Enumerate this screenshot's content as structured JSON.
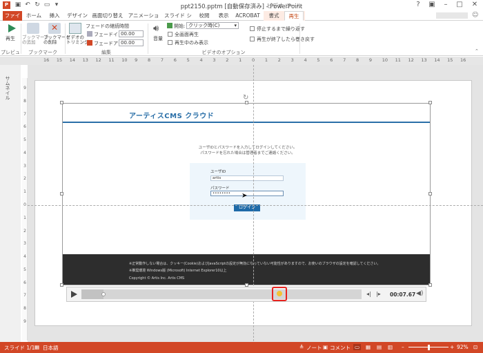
{
  "window": {
    "title": "ppt2150.pptm [自動保存済み] - PowerPoint",
    "context_tab_group": "ビデオ ツール"
  },
  "tabs": [
    "ファイル",
    "ホーム",
    "挿入",
    "デザイン",
    "画面切り替え",
    "アニメーション",
    "スライド ショー",
    "校閲",
    "表示",
    "ACROBAT",
    "書式",
    "再生"
  ],
  "ribbon": {
    "play_label": "再生",
    "add_bookmark_label": "ブックマーク\nの追加",
    "remove_bookmark_label": "ブックマーク\nの削除",
    "trim_label": "ビデオの\nトリミング",
    "fade_duration_label": "フェードの継続時間",
    "fade_in_label": "フェードイン:",
    "fade_in_value": "00.00",
    "fade_out_label": "フェードアウト:",
    "fade_out_value": "00.00",
    "volume_label": "音量",
    "start_label": "開始:",
    "start_value": "クリック時(C)",
    "fullscreen_label": "全画面再生",
    "hide_label": "再生中のみ表示",
    "loop_label": "停止するまで繰り返す",
    "rewind_label": "再生が終了したら巻き戻す",
    "groups": {
      "preview": "プレビュー",
      "bookmark": "ブックマーク",
      "edit": "編集",
      "video_options": "ビデオのオプション"
    }
  },
  "ruler": {
    "h_ticks": [
      "16",
      "15",
      "14",
      "13",
      "12",
      "11",
      "10",
      "9",
      "8",
      "7",
      "6",
      "5",
      "4",
      "3",
      "2",
      "1",
      "0",
      "1",
      "2",
      "3",
      "4",
      "5",
      "6",
      "7",
      "8",
      "9",
      "10",
      "11",
      "12",
      "13",
      "14",
      "15",
      "16"
    ],
    "v_ticks": [
      "9",
      "8",
      "7",
      "6",
      "5",
      "4",
      "3",
      "2",
      "1",
      "0",
      "1",
      "2",
      "3",
      "4",
      "5",
      "6",
      "7",
      "8",
      "9"
    ]
  },
  "thumbnail_label": "サムネイル",
  "video_content": {
    "logo": "アーティスCMS クラウド",
    "note_line1": "ユーザIDとパスワードを入力してログインしてください。",
    "note_line2": "パスワードを忘れた場合は管理者までご連絡ください。",
    "user_label": "ユーザID",
    "user_value": "artis",
    "password_label": "パスワード",
    "password_value": "••••••••",
    "login_button": "ログイン",
    "footer_line1": "※正常動作しない場合は、クッキー(Cookie)およびJavaScriptの設定が無効になっていない可能性がありますので、お使いのブラウザの設定を確認してください。",
    "footer_line2": "※推奨環境 Windows版 (Microsoft) Internet Explorer10以上",
    "copyright": "Copyright © Artis Inc. Artis CMS"
  },
  "player": {
    "time": "00:07.67",
    "progress": 0.08
  },
  "status": {
    "slide": "スライド 1/1",
    "language": "日本語",
    "notes": "ノート",
    "comments": "コメント",
    "zoom": "92%"
  },
  "colors": {
    "accent": "#d24726",
    "highlight": "#e8231f",
    "video_blue": "#2a6fa8"
  }
}
